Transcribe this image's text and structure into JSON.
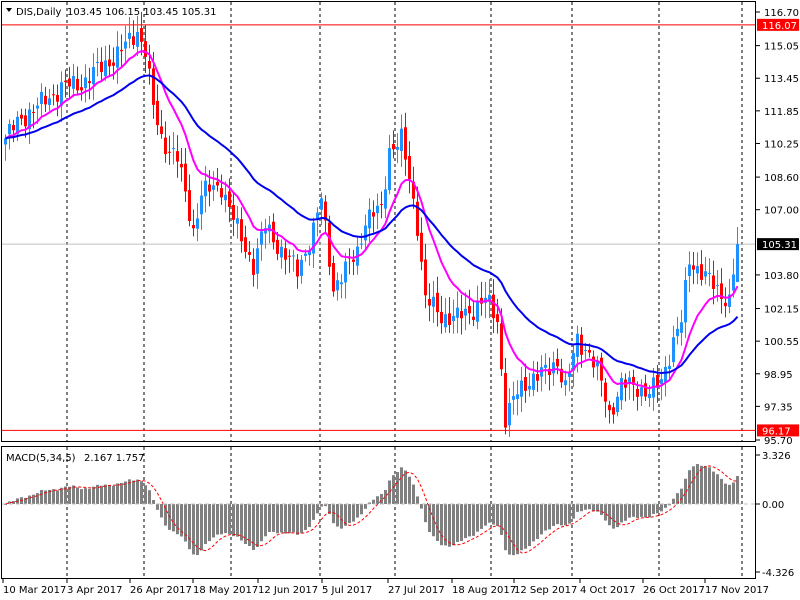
{
  "header": {
    "symbol_label": "DIS,Daily",
    "ohlc_readout": "103.45 106.15 103.45 105.31"
  },
  "macd_header": {
    "label": "MACD(5,34,5)",
    "values": "2.167 1.757"
  },
  "colors": {
    "up": "#1e90ff",
    "down": "#ff0000",
    "ma_fast": "#ff00ff",
    "ma_slow": "#0000ee",
    "level_line": "#ff0000",
    "current_line": "#c0c0c0",
    "macd_hist": "#808080",
    "macd_signal": "#ff0000"
  },
  "chart_data": [
    {
      "type": "candlestick",
      "title": "DIS,Daily",
      "ylim": [
        95.7,
        116.7
      ],
      "price_ticks": [
        "116.70",
        "115.05",
        "113.45",
        "111.85",
        "110.25",
        "108.60",
        "107.00",
        "103.80",
        "102.15",
        "100.55",
        "98.95",
        "97.35",
        "95.70"
      ],
      "levels": [
        {
          "label": "116.07",
          "value": 116.07,
          "style": "red"
        },
        {
          "label": "96.17",
          "value": 96.17,
          "style": "red"
        },
        {
          "label": "105.31",
          "value": 105.31,
          "style": "current"
        }
      ],
      "x_labels": [
        "10 Mar 2017",
        "3 Apr 2017",
        "26 Apr 2017",
        "18 May 2017",
        "12 Jun 2017",
        "5 Jul 2017",
        "27 Jul 2017",
        "18 Aug 2017",
        "12 Sep 2017",
        "4 Oct 2017",
        "26 Oct 2017",
        "17 Nov 2017"
      ],
      "bar_count": 184,
      "close_waypoints": [
        [
          0,
          110.5
        ],
        [
          4,
          111.5
        ],
        [
          9,
          112.2
        ],
        [
          14,
          113
        ],
        [
          19,
          113.2
        ],
        [
          24,
          114
        ],
        [
          29,
          114.8
        ],
        [
          33,
          115.8
        ],
        [
          35,
          114.8
        ],
        [
          37,
          112
        ],
        [
          39,
          110.5
        ],
        [
          43,
          109.5
        ],
        [
          47,
          106
        ],
        [
          49,
          107.8
        ],
        [
          54,
          108.2
        ],
        [
          58,
          106
        ],
        [
          62,
          104.3
        ],
        [
          65,
          106.2
        ],
        [
          69,
          105
        ],
        [
          73,
          104
        ],
        [
          77,
          106
        ],
        [
          79,
          107.5
        ],
        [
          82,
          103.2
        ],
        [
          85,
          104
        ],
        [
          88,
          105
        ],
        [
          90,
          106.5
        ],
        [
          94,
          107
        ],
        [
          96,
          110
        ],
        [
          99,
          110.4
        ],
        [
          101,
          108.5
        ],
        [
          103,
          106.3
        ],
        [
          105,
          102.6
        ],
        [
          109,
          101.8
        ],
        [
          113,
          101.7
        ],
        [
          116,
          102
        ],
        [
          120,
          102.6
        ],
        [
          123,
          101.6
        ],
        [
          125,
          96.8
        ],
        [
          128,
          98
        ],
        [
          131,
          98.7
        ],
        [
          135,
          99
        ],
        [
          138,
          99.6
        ],
        [
          140,
          98.2
        ],
        [
          143,
          100.6
        ],
        [
          146,
          100
        ],
        [
          149,
          98.5
        ],
        [
          151,
          97
        ],
        [
          154,
          98.4
        ],
        [
          158,
          98.3
        ],
        [
          161,
          98
        ],
        [
          164,
          98.6
        ],
        [
          167,
          100.6
        ],
        [
          169,
          101.5
        ],
        [
          171,
          104.5
        ],
        [
          174,
          104
        ],
        [
          178,
          103
        ],
        [
          181,
          102.6
        ],
        [
          183,
          105.31
        ]
      ],
      "indicators": [
        "fast moving average (magenta)",
        "slow moving average (blue)"
      ]
    },
    {
      "type": "bar",
      "title": "MACD(5,34,5)",
      "ylim": [
        -4.326,
        3.326
      ],
      "ticks": [
        "3.326",
        "0.00",
        "-4.326"
      ],
      "last_values": [
        2.167,
        1.757
      ]
    }
  ]
}
